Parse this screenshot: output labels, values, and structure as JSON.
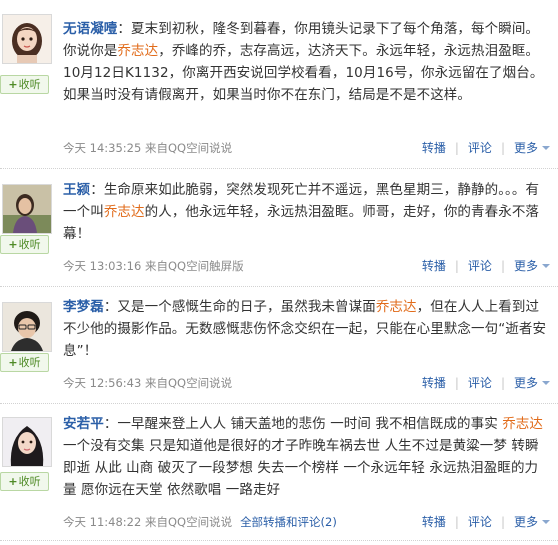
{
  "listen_label": "收听",
  "actions": {
    "repost": "转播",
    "comment": "评论",
    "more": "更多"
  },
  "posts": [
    {
      "name": "无语凝噎",
      "colon": "：",
      "text1": "夏末到初秋，隆冬到暮春，你用镜头记录下了每个角落，每个瞬间。你说你是",
      "mention": "乔志达",
      "text2": "，乔峰的乔，志存高远，达济天下。永远年轻，永远热泪盈眶。 10月12日K1132，你离开西安说回学校看看，10月16号，你永远留在了烟台。如果当时没有请假离开，如果当时你不在东门，结局是不是不这样。",
      "time": "今天 14:35:25 来自QQ空间说说",
      "repost_all": ""
    },
    {
      "name": "王颍",
      "colon": "：",
      "text1": "生命原来如此脆弱，突然发现死亡并不遥远，黑色星期三，静静的。。。有一个叫",
      "mention": "乔志达",
      "text2": "的人，他永远年轻，永远热泪盈眶。师哥，走好，你的青春永不落幕！",
      "time": "今天 13:03:16 来自QQ空间触屏版",
      "repost_all": ""
    },
    {
      "name": "李梦磊",
      "colon": "：",
      "text1": "又是一个感慨生命的日子，虽然我未曾谋面",
      "mention": "乔志达",
      "text2": "，但在人人上看到过不少他的摄影作品。无数感慨悲伤怀念交织在一起，只能在心里默念一句“逝者安息”！",
      "time": "今天 12:56:43 来自QQ空间说说",
      "repost_all": ""
    },
    {
      "name": "安若平",
      "colon": "：",
      "text1": "一早醒来登上人人 铺天盖地的悲伤 一时间 我不相信既成的事实 ",
      "mention": "乔志达",
      "text2": " 一个没有交集 只是知道他是很好的才子昨晚车祸去世 人生不过是黄粱一梦 转瞬即逝 从此 山商 破灭了一段梦想 失去一个榜样 一个永远年轻 永远热泪盈眶的力量 愿你远在天堂 依然歌唱 一路走好",
      "time": "今天 11:48:22 来自QQ空间说说",
      "repost_all": "全部转播和评论(2)"
    }
  ]
}
